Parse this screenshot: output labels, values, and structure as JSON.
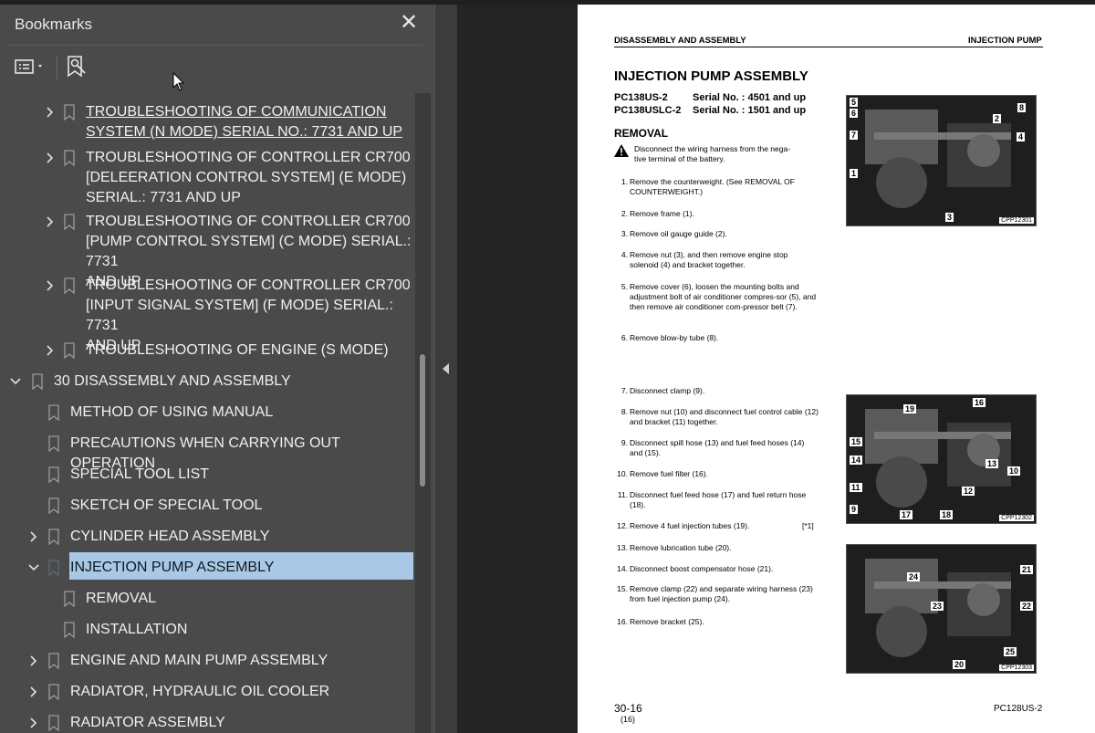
{
  "sidebar": {
    "title": "Bookmarks",
    "close_glyph": "✕",
    "tools": {
      "options_icon": "list-options-icon",
      "find_icon": "find-bookmark-icon"
    },
    "items": [
      {
        "label": "TROUBLESHOOTING OF COMMUNICATION\nSYSTEM (N MODE) SERIAL NO.: 7731 AND UP",
        "state": "collapsed",
        "underlined": true
      },
      {
        "label": "TROUBLESHOOTING OF CONTROLLER CR700\n[DELEERATION CONTROL SYSTEM] (E MODE)\nSERIAL.: 7731 AND UP",
        "state": "collapsed"
      },
      {
        "label": "TROUBLESHOOTING OF CONTROLLER CR700\n[PUMP CONTROL SYSTEM] (C MODE) SERIAL.: 7731\nAND UP",
        "state": "collapsed"
      },
      {
        "label": "TROUBLESHOOTING OF CONTROLLER CR700\n[INPUT SIGNAL SYSTEM] (F MODE) SERIAL.: 7731\nAND UP",
        "state": "collapsed"
      },
      {
        "label": "TROUBLESHOOTING OF ENGINE (S MODE)",
        "state": "collapsed"
      },
      {
        "label": "30 DISASSEMBLY AND ASSEMBLY",
        "state": "expanded"
      },
      {
        "label": "METHOD OF USING MANUAL",
        "state": "leaf"
      },
      {
        "label": "PRECAUTIONS WHEN CARRYING OUT OPERATION",
        "state": "leaf"
      },
      {
        "label": "SPECIAL TOOL LIST",
        "state": "leaf"
      },
      {
        "label": "SKETCH OF SPECIAL TOOL",
        "state": "leaf"
      },
      {
        "label": "CYLINDER HEAD ASSEMBLY",
        "state": "collapsed"
      },
      {
        "label": "INJECTION PUMP ASSEMBLY",
        "state": "expanded",
        "selected": true
      },
      {
        "label": "REMOVAL",
        "state": "leaf"
      },
      {
        "label": "INSTALLATION",
        "state": "leaf"
      },
      {
        "label": "ENGINE AND MAIN PUMP ASSEMBLY",
        "state": "collapsed"
      },
      {
        "label": "RADIATOR, HYDRAULIC OIL COOLER",
        "state": "collapsed"
      },
      {
        "label": "RADIATOR ASSEMBLY",
        "state": "collapsed"
      }
    ]
  },
  "document": {
    "header_left": "DISASSEMBLY AND ASSEMBLY",
    "header_right": "INJECTION PUMP",
    "title": "INJECTION PUMP ASSEMBLY",
    "models": [
      {
        "model": "PC138US-2",
        "serial": "Serial No. : 4501 and up"
      },
      {
        "model": "PC138USLC-2",
        "serial": "Serial No. : 1501 and up"
      }
    ],
    "section": "REMOVAL",
    "warning": "Disconnect the wiring harness from the nega-\ntive terminal of the battery.",
    "steps": [
      {
        "n": "1.",
        "t": "Remove the counterweight.  (See REMOVAL OF COUNTERWEIGHT.)"
      },
      {
        "n": "2.",
        "t": "Remove frame (1)."
      },
      {
        "n": "3.",
        "t": "Remove oil gauge guide (2)."
      },
      {
        "n": "4.",
        "t": "Remove nut (3), and then remove engine stop solenoid (4) and bracket together."
      },
      {
        "n": "5.",
        "t": "Remove cover (6), loosen the mounting bolts and adjustment bolt of air conditioner compres-sor (5), and then remove air conditioner com-pressor belt (7)."
      },
      {
        "n": "6.",
        "t": "Remove blow-by tube (8)."
      },
      {
        "n": "7.",
        "t": "Disconnect clamp (9)."
      },
      {
        "n": "8.",
        "t": "Remove nut (10) and disconnect fuel control cable (12) and bracket (11) together."
      },
      {
        "n": "9.",
        "t": "Disconnect spill hose (13) and fuel feed hoses (14) and (15)."
      },
      {
        "n": "10.",
        "t": "Remove fuel filter (16)."
      },
      {
        "n": "11.",
        "t": "Disconnect fuel feed hose (17) and fuel return hose (18)."
      },
      {
        "n": "12.",
        "t": "Remove 4 fuel injection tubes (19).",
        "mark": "[*1]"
      },
      {
        "n": "13.",
        "t": "Remove lubrication tube (20)."
      },
      {
        "n": "14.",
        "t": "Disconnect boost compensator hose (21)."
      },
      {
        "n": "15.",
        "t": "Remove clamp (22) and separate wiring harness (23) from fuel injection pump (24)."
      },
      {
        "n": "16.",
        "t": "Remove bracket (25)."
      }
    ],
    "figures": [
      {
        "code": "CPP12301",
        "callouts": [
          "5",
          "6",
          "7",
          "8",
          "2",
          "4",
          "1",
          "3"
        ]
      },
      {
        "code": "CPP12302",
        "callouts": [
          "16",
          "19",
          "15",
          "14",
          "13",
          "10",
          "11",
          "12",
          "9",
          "17",
          "18"
        ]
      },
      {
        "code": "CPP12303",
        "callouts": [
          "21",
          "24",
          "23",
          "22",
          "25",
          "20"
        ]
      }
    ],
    "footer_page": "30-16",
    "footer_sub": "(16)",
    "footer_model": "PC128US-2"
  }
}
